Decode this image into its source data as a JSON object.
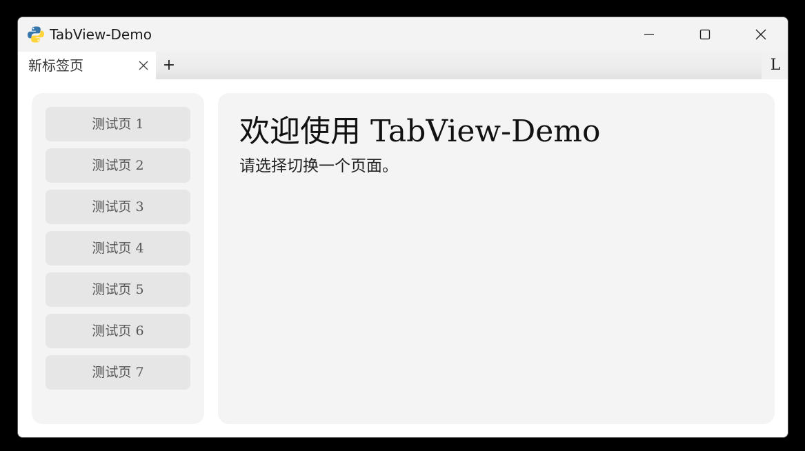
{
  "window": {
    "title": "TabView-Demo",
    "icon": "python-icon"
  },
  "controls": {
    "minimize_icon": "minimize-icon",
    "maximize_icon": "maximize-icon",
    "close_icon": "close-icon"
  },
  "tabs": [
    {
      "label": "新标签页",
      "active": true
    }
  ],
  "tabbar": {
    "add_label": "+",
    "right_label": "L"
  },
  "sidebar": {
    "items": [
      {
        "label": "测试页 1"
      },
      {
        "label": "测试页 2"
      },
      {
        "label": "测试页 3"
      },
      {
        "label": "测试页 4"
      },
      {
        "label": "测试页 5"
      },
      {
        "label": "测试页 6"
      },
      {
        "label": "测试页 7"
      }
    ]
  },
  "main": {
    "title": "欢迎使用 TabView-Demo",
    "subtitle": "请选择切换一个页面。"
  },
  "colors": {
    "window_background": "#ffffff",
    "panel_background": "#f4f4f4",
    "sidebar_button": "#e6e6e6",
    "titlebar": "#f3f3f3"
  }
}
